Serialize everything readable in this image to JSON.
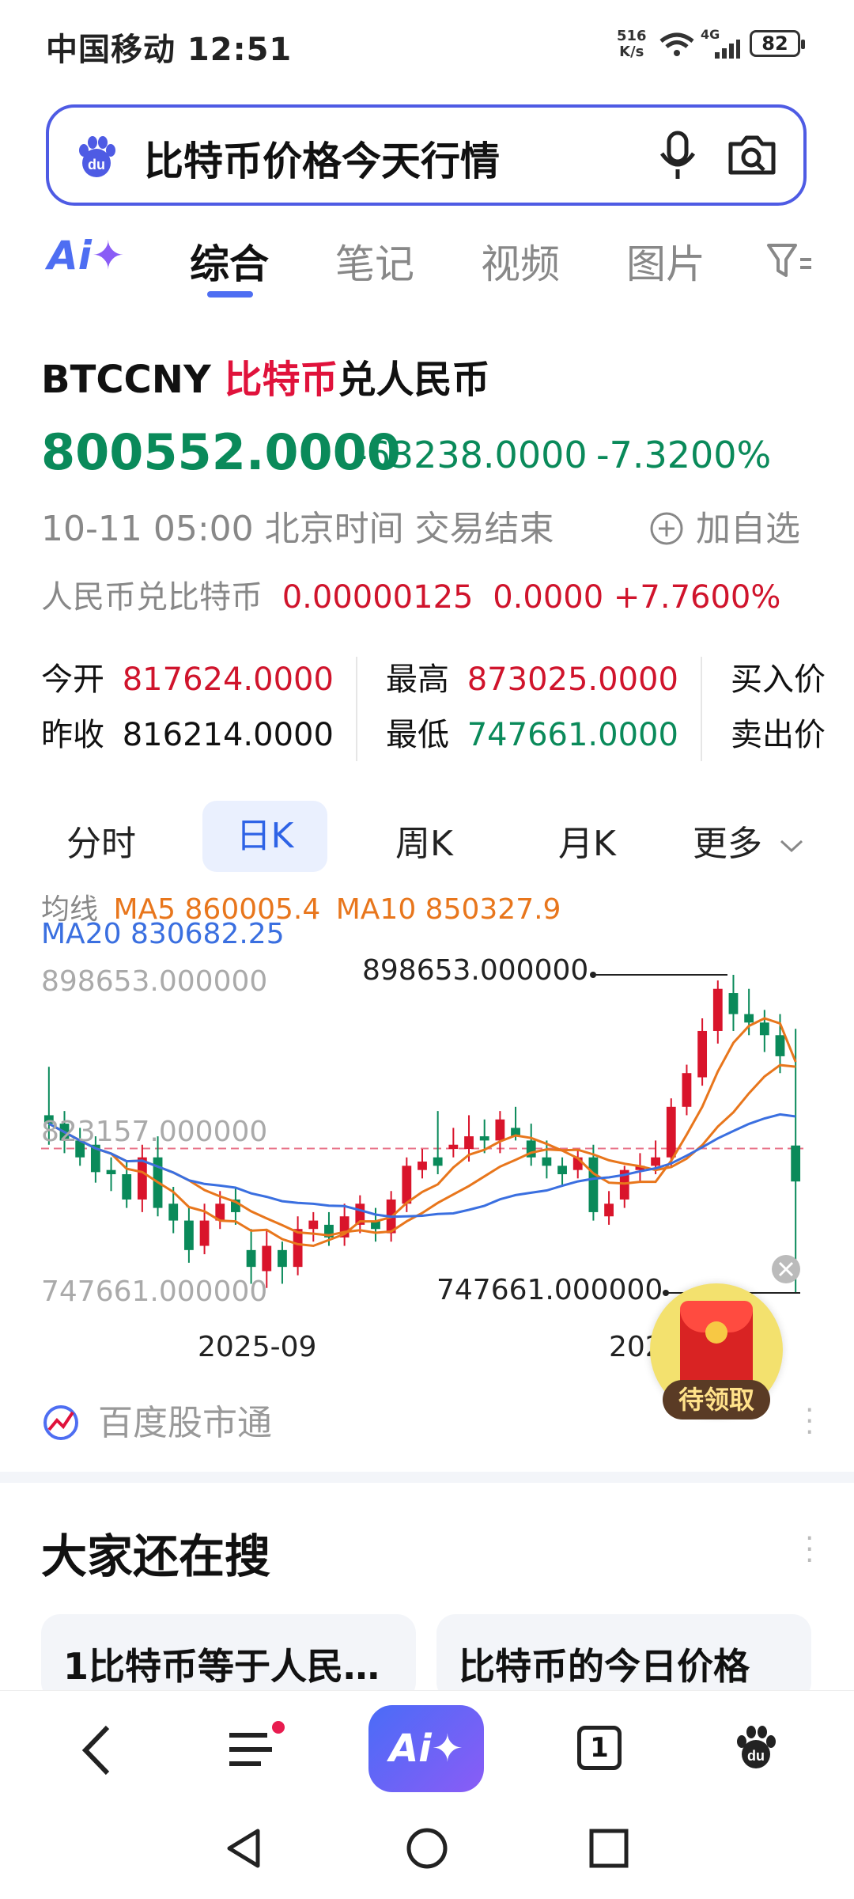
{
  "status_bar": {
    "carrier_time": "中国移动 12:51",
    "net_speed": "516",
    "net_unit": "K/s",
    "signal": "4G",
    "battery": "82"
  },
  "search": {
    "query": "比特币价格今天行情",
    "logo_icon": "baidu-paw-icon",
    "mic_icon": "microphone-icon",
    "camera_icon": "camera-search-icon"
  },
  "tabs": {
    "ai_label": "Ai",
    "items": [
      "综合",
      "笔记",
      "视频",
      "图片"
    ],
    "active": "综合",
    "filter_icon": "filter-icon"
  },
  "stock": {
    "code": "BTCCNY",
    "name_red": "比特币",
    "name_rest": "兑人民币",
    "price": "800552.0000",
    "change": "-63238.0000",
    "change_pct": "-7.3200%",
    "time_status": "10-11 05:00 北京时间 交易结束",
    "add_watch": "加自选",
    "inverse_label": "人民币兑比特币",
    "inverse_price": "0.00000125",
    "inverse_change": "0.0000",
    "inverse_pct": "+7.7600%"
  },
  "quotes": {
    "open_label": "今开",
    "open": "817624.0000",
    "prev_close_label": "昨收",
    "prev_close": "816214.0000",
    "high_label": "最高",
    "high": "873025.0000",
    "low_label": "最低",
    "low": "747661.0000",
    "bid_label": "买入价",
    "ask_label": "卖出价"
  },
  "period_tabs": {
    "items": [
      "分时",
      "日K",
      "周K",
      "月K"
    ],
    "selected": "日K",
    "more": "更多"
  },
  "ma": {
    "label": "均线",
    "ma5": "MA5 860005.4",
    "ma10": "MA10 850327.9",
    "ma20": "MA20 830682.25",
    "ma5_color": "#e8761c",
    "ma10_color": "#e8761c",
    "ma20_color": "#3a6fe0"
  },
  "chart_data": {
    "type": "candlestick",
    "y_ticks": [
      "898653.000000",
      "823157.000000",
      "747661.000000"
    ],
    "ylim": [
      747661,
      898653
    ],
    "max_label": "898653.000000",
    "min_label": "747661.000000",
    "x_labels": [
      "2025-09",
      "2025-10"
    ],
    "reference_line": 816214,
    "colors": {
      "up": "#d9142b",
      "down": "#0a8a5a",
      "ref": "#e8758a"
    },
    "candles": [
      {
        "o": 832000,
        "c": 828000,
        "h": 855000,
        "l": 818000
      },
      {
        "o": 828000,
        "c": 820000,
        "h": 834000,
        "l": 814000
      },
      {
        "o": 820000,
        "c": 812000,
        "h": 826000,
        "l": 808000
      },
      {
        "o": 818000,
        "c": 805000,
        "h": 822000,
        "l": 800000
      },
      {
        "o": 806000,
        "c": 804000,
        "h": 812000,
        "l": 796000
      },
      {
        "o": 804000,
        "c": 792000,
        "h": 810000,
        "l": 788000
      },
      {
        "o": 792000,
        "c": 812000,
        "h": 818000,
        "l": 786000
      },
      {
        "o": 812000,
        "c": 788000,
        "h": 822000,
        "l": 784000
      },
      {
        "o": 790000,
        "c": 782000,
        "h": 798000,
        "l": 776000
      },
      {
        "o": 782000,
        "c": 768000,
        "h": 788000,
        "l": 762000
      },
      {
        "o": 770000,
        "c": 782000,
        "h": 790000,
        "l": 766000
      },
      {
        "o": 782000,
        "c": 790000,
        "h": 796000,
        "l": 778000
      },
      {
        "o": 792000,
        "c": 786000,
        "h": 798000,
        "l": 780000
      },
      {
        "o": 768000,
        "c": 760000,
        "h": 778000,
        "l": 752000
      },
      {
        "o": 758000,
        "c": 770000,
        "h": 778000,
        "l": 750000
      },
      {
        "o": 768000,
        "c": 760000,
        "h": 772000,
        "l": 752000
      },
      {
        "o": 760000,
        "c": 778000,
        "h": 784000,
        "l": 756000
      },
      {
        "o": 778000,
        "c": 782000,
        "h": 786000,
        "l": 772000
      },
      {
        "o": 780000,
        "c": 774000,
        "h": 786000,
        "l": 770000
      },
      {
        "o": 774000,
        "c": 784000,
        "h": 790000,
        "l": 770000
      },
      {
        "o": 780000,
        "c": 790000,
        "h": 794000,
        "l": 776000
      },
      {
        "o": 782000,
        "c": 778000,
        "h": 788000,
        "l": 772000
      },
      {
        "o": 776000,
        "c": 792000,
        "h": 796000,
        "l": 772000
      },
      {
        "o": 790000,
        "c": 808000,
        "h": 812000,
        "l": 786000
      },
      {
        "o": 806000,
        "c": 810000,
        "h": 816000,
        "l": 802000
      },
      {
        "o": 812000,
        "c": 808000,
        "h": 834000,
        "l": 804000
      },
      {
        "o": 816000,
        "c": 818000,
        "h": 826000,
        "l": 812000
      },
      {
        "o": 816000,
        "c": 822000,
        "h": 832000,
        "l": 810000
      },
      {
        "o": 822000,
        "c": 820000,
        "h": 830000,
        "l": 814000
      },
      {
        "o": 820000,
        "c": 830000,
        "h": 834000,
        "l": 814000
      },
      {
        "o": 826000,
        "c": 822000,
        "h": 836000,
        "l": 820000
      },
      {
        "o": 820000,
        "c": 812000,
        "h": 828000,
        "l": 808000
      },
      {
        "o": 812000,
        "c": 808000,
        "h": 820000,
        "l": 802000
      },
      {
        "o": 808000,
        "c": 804000,
        "h": 812000,
        "l": 798000
      },
      {
        "o": 806000,
        "c": 812000,
        "h": 816000,
        "l": 802000
      },
      {
        "o": 812000,
        "c": 786000,
        "h": 818000,
        "l": 782000
      },
      {
        "o": 784000,
        "c": 790000,
        "h": 796000,
        "l": 780000
      },
      {
        "o": 792000,
        "c": 806000,
        "h": 808000,
        "l": 788000
      },
      {
        "o": 806000,
        "c": 808000,
        "h": 814000,
        "l": 800000
      },
      {
        "o": 808000,
        "c": 812000,
        "h": 820000,
        "l": 804000
      },
      {
        "o": 812000,
        "c": 836000,
        "h": 840000,
        "l": 808000
      },
      {
        "o": 836000,
        "c": 852000,
        "h": 856000,
        "l": 832000
      },
      {
        "o": 850000,
        "c": 872000,
        "h": 878000,
        "l": 846000
      },
      {
        "o": 872000,
        "c": 892000,
        "h": 896000,
        "l": 866000
      },
      {
        "o": 890000,
        "c": 880000,
        "h": 898653,
        "l": 872000
      },
      {
        "o": 880000,
        "c": 876000,
        "h": 892000,
        "l": 870000
      },
      {
        "o": 876000,
        "c": 870000,
        "h": 882000,
        "l": 862000
      },
      {
        "o": 870000,
        "c": 860000,
        "h": 880000,
        "l": 852000
      },
      {
        "o": 817624,
        "c": 800552,
        "h": 873025,
        "l": 747661
      }
    ]
  },
  "source": {
    "label": "百度股市通"
  },
  "red_packet": {
    "label": "待领取"
  },
  "section": {
    "title": "大家还在搜"
  },
  "cards": [
    "1比特币等于人民…",
    "比特币的今日价格"
  ],
  "bottom_nav": {
    "ai_label": "Ai",
    "tab_count": "1"
  }
}
